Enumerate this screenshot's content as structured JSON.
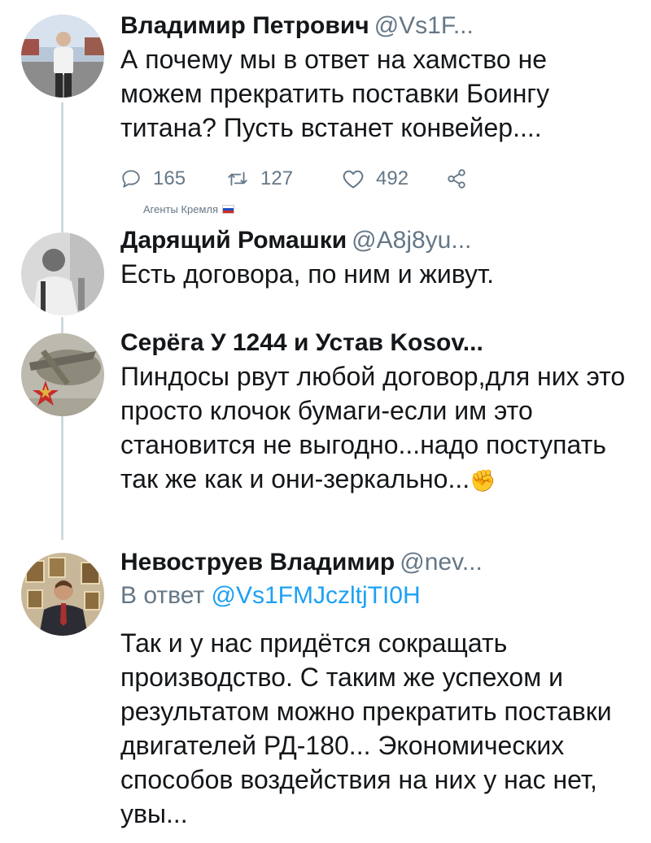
{
  "tweets": [
    {
      "name": "Владимир Петрович",
      "handle": "@Vs1F...",
      "text": "А почему мы в ответ на хамство не можем прекратить поставки Боингу титана? Пусть встанет конвейер....",
      "actions": {
        "replies": "165",
        "retweets": "127",
        "likes": "492"
      }
    },
    {
      "group_label": "Агенты Кремля",
      "name": "Дарящий Ромашки",
      "handle": "@A8j8yu...",
      "text": "Есть договора, по ним и живут."
    },
    {
      "name": "Серёга У 1244 и Устав Kosov...",
      "handle": "",
      "text": "Пиндосы рвут любой договор,для них это просто клочок бумаги-если им это становится не выгодно...надо поступать так же как и они-зеркально..."
    },
    {
      "name": "Невоструев Владимир",
      "handle": "@nev...",
      "reply_prefix": "В ответ",
      "reply_mention": "@Vs1FMJczltjTI0H",
      "text": "Так и у нас придётся сокращать производство. С таким же успехом и результатом можно прекратить поставки двигателей РД-180... Экономических способов воздействия на них у нас нет, увы..."
    }
  ],
  "icons": {
    "reply": "reply-icon",
    "retweet": "retweet-icon",
    "like": "heart-icon",
    "share": "share-icon",
    "emoji": "fist-emoji"
  },
  "colors": {
    "text": "#14171a",
    "secondary": "#657786",
    "mention": "#1da1f2",
    "thread_line": "#cfd9de"
  }
}
